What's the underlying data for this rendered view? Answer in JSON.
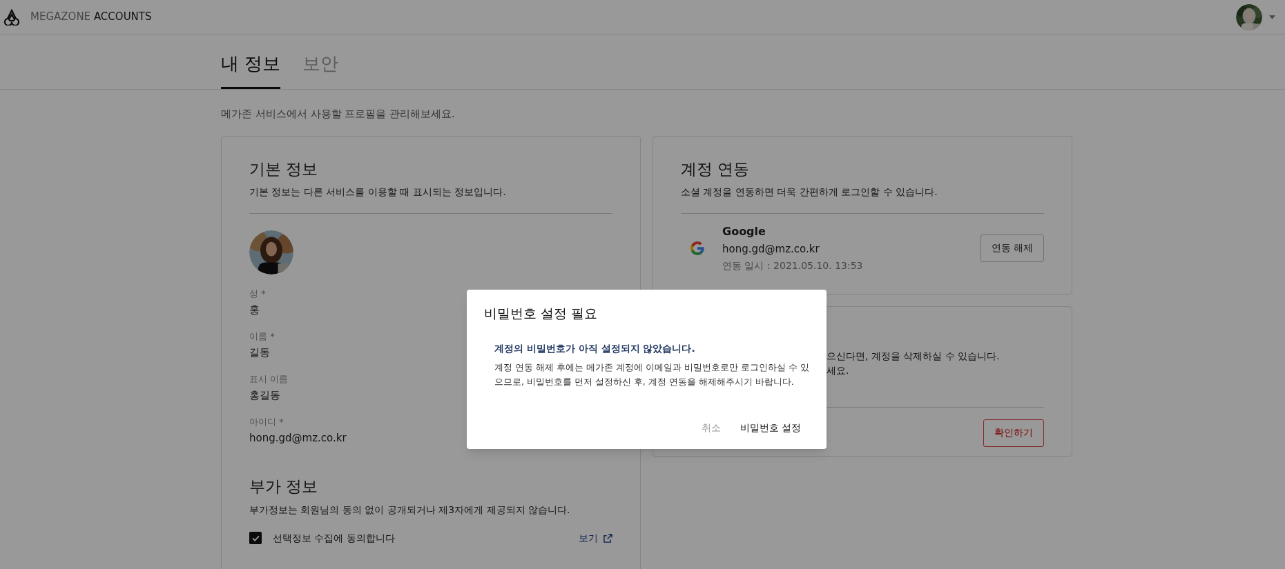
{
  "header": {
    "brand_light": "MEGAZONE",
    "brand_dark": "ACCOUNTS"
  },
  "tabs": [
    {
      "label": "내 정보",
      "selected": true
    },
    {
      "label": "보안",
      "selected": false
    }
  ],
  "intro": "메가존 서비스에서 사용할 프로필을 관리해보세요.",
  "basic_info": {
    "title": "기본 정보",
    "description": "기본 정보는 다른 서비스를 이용할 때 표시되는 정보입니다.",
    "fields": [
      {
        "label": "성 *",
        "value": "홍"
      },
      {
        "label": "이름 *",
        "value": "길동"
      },
      {
        "label": "표시 이름",
        "value": "홍길동"
      },
      {
        "label": "아이디 *",
        "value": "hong.gd@mz.co.kr"
      }
    ]
  },
  "extra_info": {
    "title": "부가 정보",
    "description": "부가정보는 회원님의 동의 없이 공개되거나 제3자에게 제공되지 않습니다.",
    "consent": {
      "label": "선택정보 수집에 동의합니다",
      "checked": true
    },
    "link": "보기"
  },
  "linked_accounts": {
    "title": "계정 연동",
    "description": "소셜 계정을 연동하면 더욱 간편하게 로그인할 수 있습니다.",
    "accounts": [
      {
        "provider": "Google",
        "email": "hong.gd@mz.co.kr",
        "linked_at": "연동 일시 : 2021.05.10. 13:53",
        "button": "연동 해제"
      }
    ]
  },
  "delete_card": {
    "description_lines": [
      "으신다면, 계정을 삭제하실 수 있습니다.",
      "세요."
    ],
    "button": "확인하기"
  },
  "dialog": {
    "title": "비밀번호 설정 필요",
    "headline": "계정의 비밀번호가 아직 설정되지 않았습니다.",
    "body": "계정 연동 해제 후에는 메가존 계정에 이메일과 비밀번호로만 로그인하실 수 있으므로, 비밀번호를 먼저 설정하신 후, 계정 연동을 해제해주시기 바랍니다.",
    "buttons": [
      {
        "label": "취소",
        "kind": "secondary"
      },
      {
        "label": "비밀번호 설정",
        "kind": "primary"
      }
    ]
  }
}
